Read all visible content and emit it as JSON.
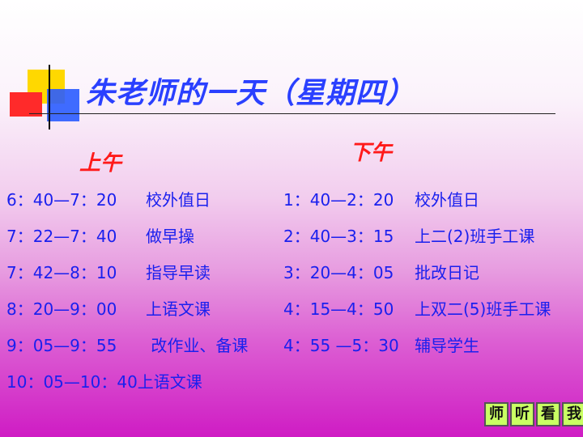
{
  "title": "朱老师的一天（星期四）",
  "morning": {
    "heading": "上午",
    "items": [
      {
        "time": "6：40—7：20",
        "activity": "校外值日"
      },
      {
        "time": "7：22—7：40",
        "activity": "做早操"
      },
      {
        "time": "7：42—8：10",
        "activity": "指导早读"
      },
      {
        "time": "8：20—9：00",
        "activity": "上语文课"
      },
      {
        "time": "9：05—9：55",
        "activity": " 改作业、备课"
      },
      {
        "time": "10：05—10：40",
        "activity": "上语文课"
      }
    ]
  },
  "afternoon": {
    "heading": "下午",
    "items": [
      {
        "time": "1：40—2：20",
        "activity": "校外值日"
      },
      {
        "time": "2：40—3：15",
        "activity": "上二(2)班手工课"
      },
      {
        "time": "3：20—4：05",
        "activity": "批改日记"
      },
      {
        "time": "4：15—4：50",
        "activity": "上双二(5)班手工课"
      },
      {
        "time": "4：55 —5：30",
        "activity": "辅导学生"
      }
    ]
  },
  "badges": [
    "师",
    "听",
    "看",
    "我"
  ],
  "colors": {
    "title": "#2a40ff",
    "heading": "#ff1a1a",
    "body_text": "#1a20ee",
    "badge_bg": "#c9ff63",
    "bg_top": "#ffffff",
    "bg_bottom": "#cf1cc4"
  }
}
